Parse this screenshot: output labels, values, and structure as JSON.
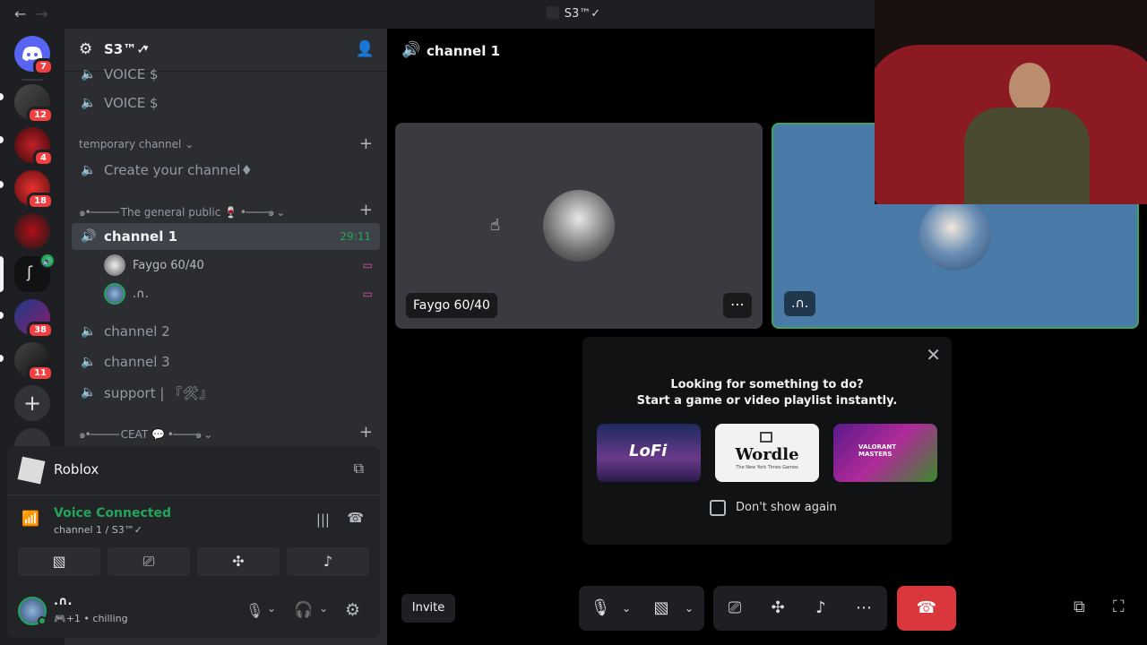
{
  "window": {
    "title": "S3™✓"
  },
  "rail": {
    "badges": [
      "7",
      "12",
      "4",
      "18",
      "38",
      "11"
    ]
  },
  "sidebar": {
    "guild_name": "S3™✓",
    "channels_top": [
      {
        "label": "VOICE $"
      },
      {
        "label": "VOICE $"
      }
    ],
    "category_temp": "temporary channel",
    "create_channel": "Create your channel♦",
    "category_general": "The general public 🍷",
    "channel1": {
      "label": "channel 1",
      "timer": "29:11"
    },
    "members": [
      {
        "name": "Faygo 60/40"
      },
      {
        "name": ".∩."
      }
    ],
    "channel2": "channel 2",
    "channel3": "channel 3",
    "support": "support | 『🛠』",
    "category_ceat": "CEAT 💬"
  },
  "activity": {
    "name": "Roblox"
  },
  "voice": {
    "status": "Voice Connected",
    "location": "channel 1 / S3™✓"
  },
  "user": {
    "name": ".∩.",
    "status_prefix": "+1",
    "status": "chilling"
  },
  "stage": {
    "channel_name": "channel 1",
    "tile1_label": "Faygo 60/40",
    "tile2_label": ".∩.",
    "popup": {
      "line1": "Looking for something to do?",
      "line2": "Start a game or video playlist instantly.",
      "dont_show": "Don't show again",
      "wordle": "Wordle",
      "wordle_sub": "The New York Times Games",
      "lofi": "LoFi",
      "valorant": "VALORANT MASTERS"
    },
    "invite_label": "Invite"
  },
  "colors": {
    "accent_green": "#23a55a",
    "danger_red": "#da373c",
    "speaking_border": "#3ba55d"
  }
}
